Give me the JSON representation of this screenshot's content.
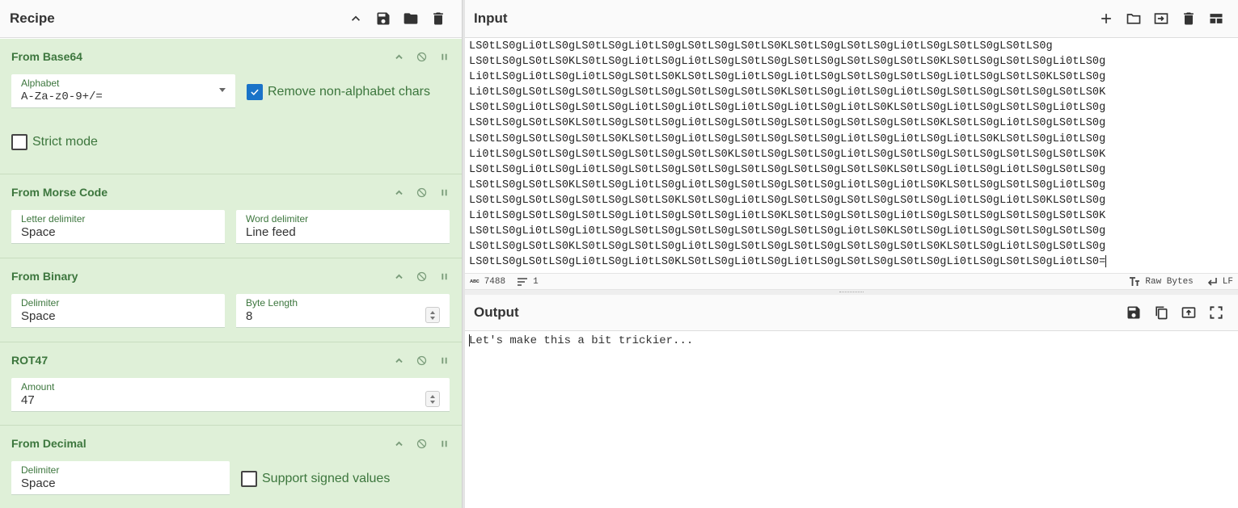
{
  "recipe": {
    "title": "Recipe",
    "operations": [
      {
        "name": "From Base64",
        "alphabet_label": "Alphabet",
        "alphabet_value": "A-Za-z0-9+/=",
        "remove_label": "Remove non-alphabet chars",
        "remove_checked": true,
        "strict_label": "Strict mode",
        "strict_checked": false
      },
      {
        "name": "From Morse Code",
        "letter_label": "Letter delimiter",
        "letter_value": "Space",
        "word_label": "Word delimiter",
        "word_value": "Line feed"
      },
      {
        "name": "From Binary",
        "delimiter_label": "Delimiter",
        "delimiter_value": "Space",
        "byte_label": "Byte Length",
        "byte_value": "8"
      },
      {
        "name": "ROT47",
        "amount_label": "Amount",
        "amount_value": "47"
      },
      {
        "name": "From Decimal",
        "delimiter_label": "Delimiter",
        "delimiter_value": "Space",
        "signed_label": "Support signed values",
        "signed_checked": false
      }
    ]
  },
  "input": {
    "title": "Input",
    "lines": [
      "LS0tLS0gLi0tLS0gLS0tLS0gLi0tLS0gLS0tLS0gLS0tLS0KLS0tLS0gLS0tLS0gLi0tLS0gLS0tLS0gLS0tLS0g",
      "LS0tLS0gLS0tLS0KLS0tLS0gLi0tLS0gLi0tLS0gLS0tLS0gLS0tLS0gLS0tLS0gLS0tLS0KLS0tLS0gLS0tLS0gLi0tLS0g",
      "Li0tLS0gLi0tLS0gLi0tLS0gLS0tLS0KLS0tLS0gLi0tLS0gLi0tLS0gLS0tLS0gLS0tLS0gLi0tLS0gLS0tLS0KLS0tLS0g",
      "Li0tLS0gLS0tLS0gLS0tLS0gLS0tLS0gLS0tLS0gLS0tLS0KLS0tLS0gLi0tLS0gLi0tLS0gLS0tLS0gLS0tLS0gLS0tLS0K",
      "LS0tLS0gLi0tLS0gLS0tLS0gLi0tLS0gLi0tLS0gLi0tLS0gLi0tLS0gLi0tLS0KLS0tLS0gLi0tLS0gLS0tLS0gLi0tLS0g",
      "LS0tLS0gLS0tLS0KLS0tLS0gLS0tLS0gLi0tLS0gLS0tLS0gLS0tLS0gLS0tLS0gLS0tLS0KLS0tLS0gLi0tLS0gLS0tLS0g",
      "LS0tLS0gLS0tLS0gLS0tLS0KLS0tLS0gLi0tLS0gLS0tLS0gLS0tLS0gLi0tLS0gLi0tLS0gLi0tLS0KLS0tLS0gLi0tLS0g",
      "Li0tLS0gLS0tLS0gLS0tLS0gLS0tLS0gLS0tLS0KLS0tLS0gLS0tLS0gLi0tLS0gLS0tLS0gLS0tLS0gLS0tLS0gLS0tLS0K",
      "LS0tLS0gLi0tLS0gLi0tLS0gLS0tLS0gLS0tLS0gLS0tLS0gLS0tLS0gLS0tLS0KLS0tLS0gLi0tLS0gLi0tLS0gLS0tLS0g",
      "LS0tLS0gLS0tLS0KLS0tLS0gLi0tLS0gLi0tLS0gLS0tLS0gLS0tLS0gLi0tLS0gLi0tLS0KLS0tLS0gLS0tLS0gLi0tLS0g",
      "LS0tLS0gLS0tLS0gLS0tLS0gLS0tLS0KLS0tLS0gLi0tLS0gLS0tLS0gLS0tLS0gLS0tLS0gLi0tLS0gLi0tLS0KLS0tLS0g",
      "Li0tLS0gLS0tLS0gLS0tLS0gLi0tLS0gLS0tLS0gLi0tLS0KLS0tLS0gLS0tLS0gLi0tLS0gLS0tLS0gLS0tLS0gLS0tLS0K",
      "LS0tLS0gLi0tLS0gLi0tLS0gLS0tLS0gLS0tLS0gLS0tLS0gLS0tLS0gLi0tLS0KLS0tLS0gLi0tLS0gLS0tLS0gLS0tLS0g",
      "LS0tLS0gLS0tLS0KLS0tLS0gLS0tLS0gLi0tLS0gLS0tLS0gLS0tLS0gLS0tLS0gLS0tLS0KLS0tLS0gLi0tLS0gLS0tLS0g",
      "LS0tLS0gLS0tLS0gLi0tLS0gLi0tLS0KLS0tLS0gLi0tLS0gLi0tLS0gLS0tLS0gLS0tLS0gLi0tLS0gLS0tLS0gLi0tLS0="
    ],
    "length": "7488",
    "line_count": "1",
    "encoding": "Raw Bytes",
    "eol": "LF"
  },
  "output": {
    "title": "Output",
    "text": "Let's make this a bit trickier..."
  }
}
